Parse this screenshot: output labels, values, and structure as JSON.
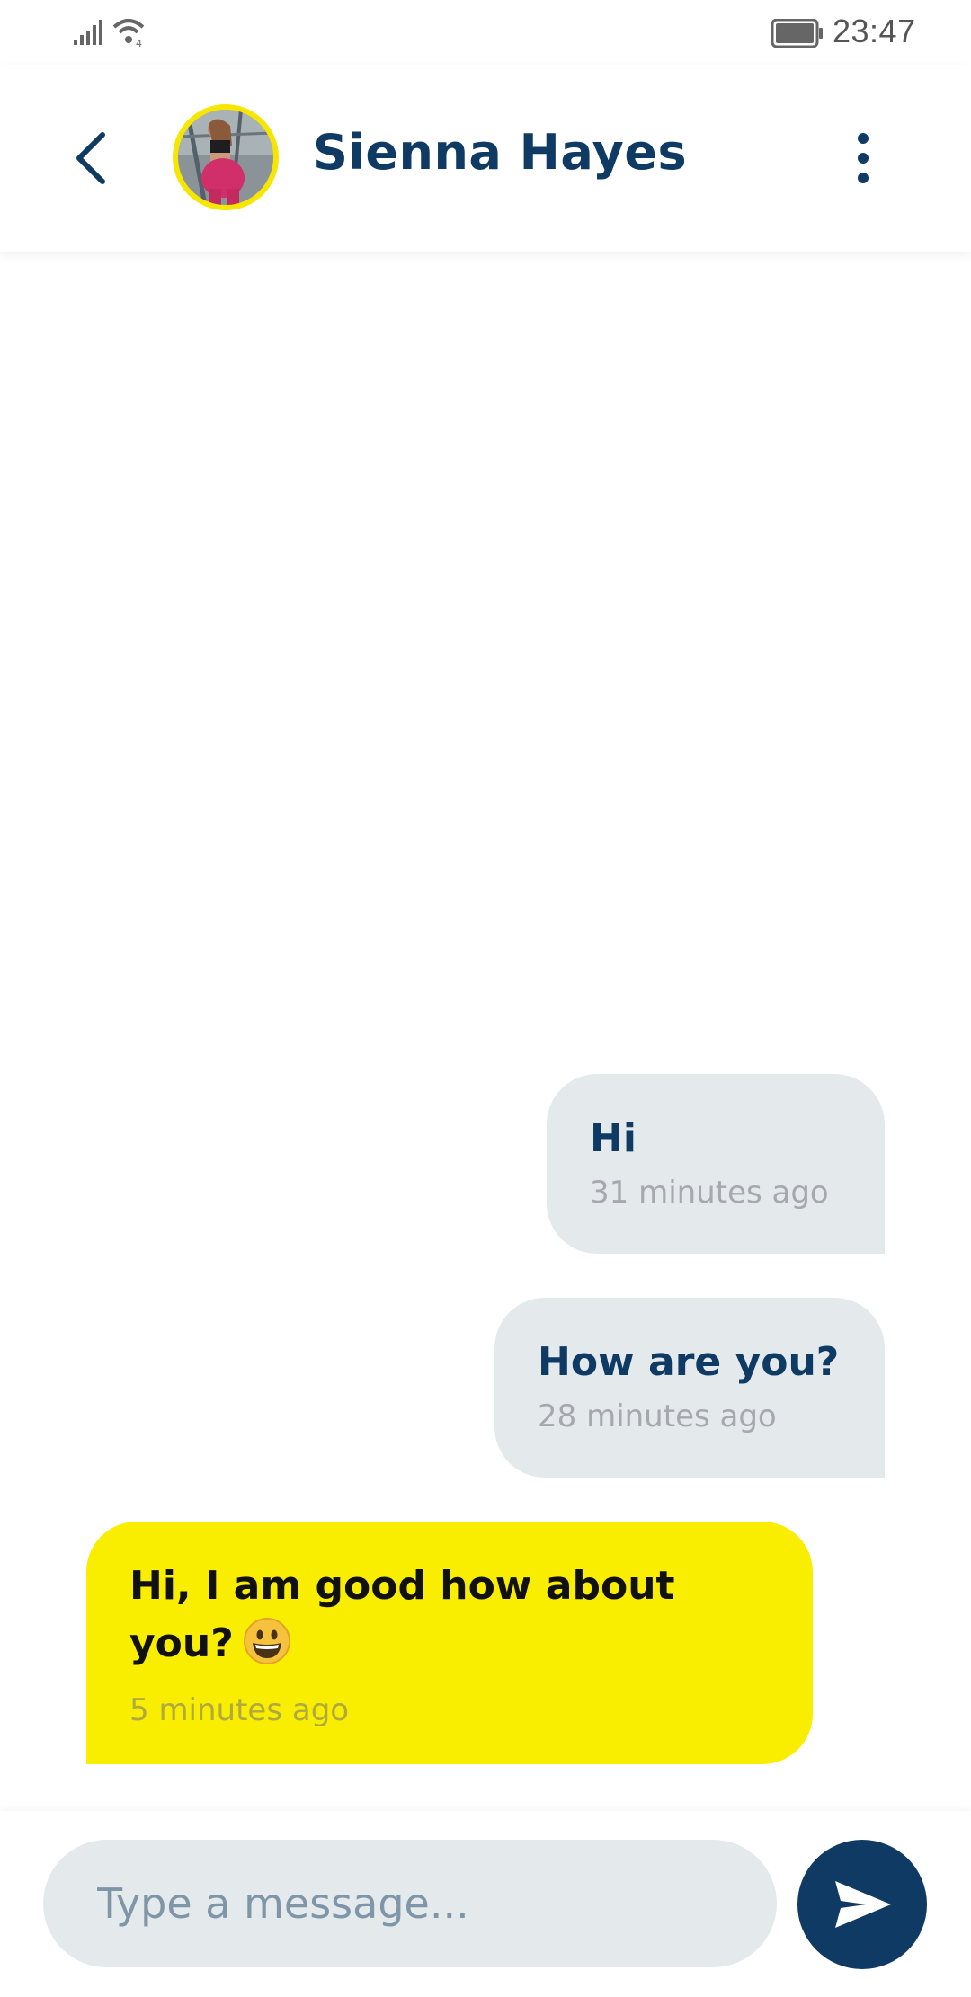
{
  "status_bar": {
    "time": "23:47",
    "icons": [
      "signal-icon",
      "wifi-icon",
      "battery-icon"
    ]
  },
  "header": {
    "back_icon": "chevron-left-icon",
    "avatar": "contact-avatar",
    "contact_name": "Sienna Hayes",
    "menu_icon": "more-vertical-icon"
  },
  "messages": [
    {
      "direction": "sent",
      "text": "Hi",
      "time": "31 minutes ago"
    },
    {
      "direction": "sent",
      "text": "How are you?",
      "time": "28 minutes ago"
    },
    {
      "direction": "received",
      "text_line1": "Hi, I am good how about",
      "text_line2": "you?",
      "emoji": "grinning-face-emoji",
      "time": "5 minutes ago"
    }
  ],
  "composer": {
    "placeholder": "Type a message...",
    "send_icon": "send-icon"
  },
  "colors": {
    "primary": "#0f3a63",
    "accent": "#faee00",
    "bubble_sent": "#e4e9ec",
    "input_bg": "#e4e9ec"
  }
}
